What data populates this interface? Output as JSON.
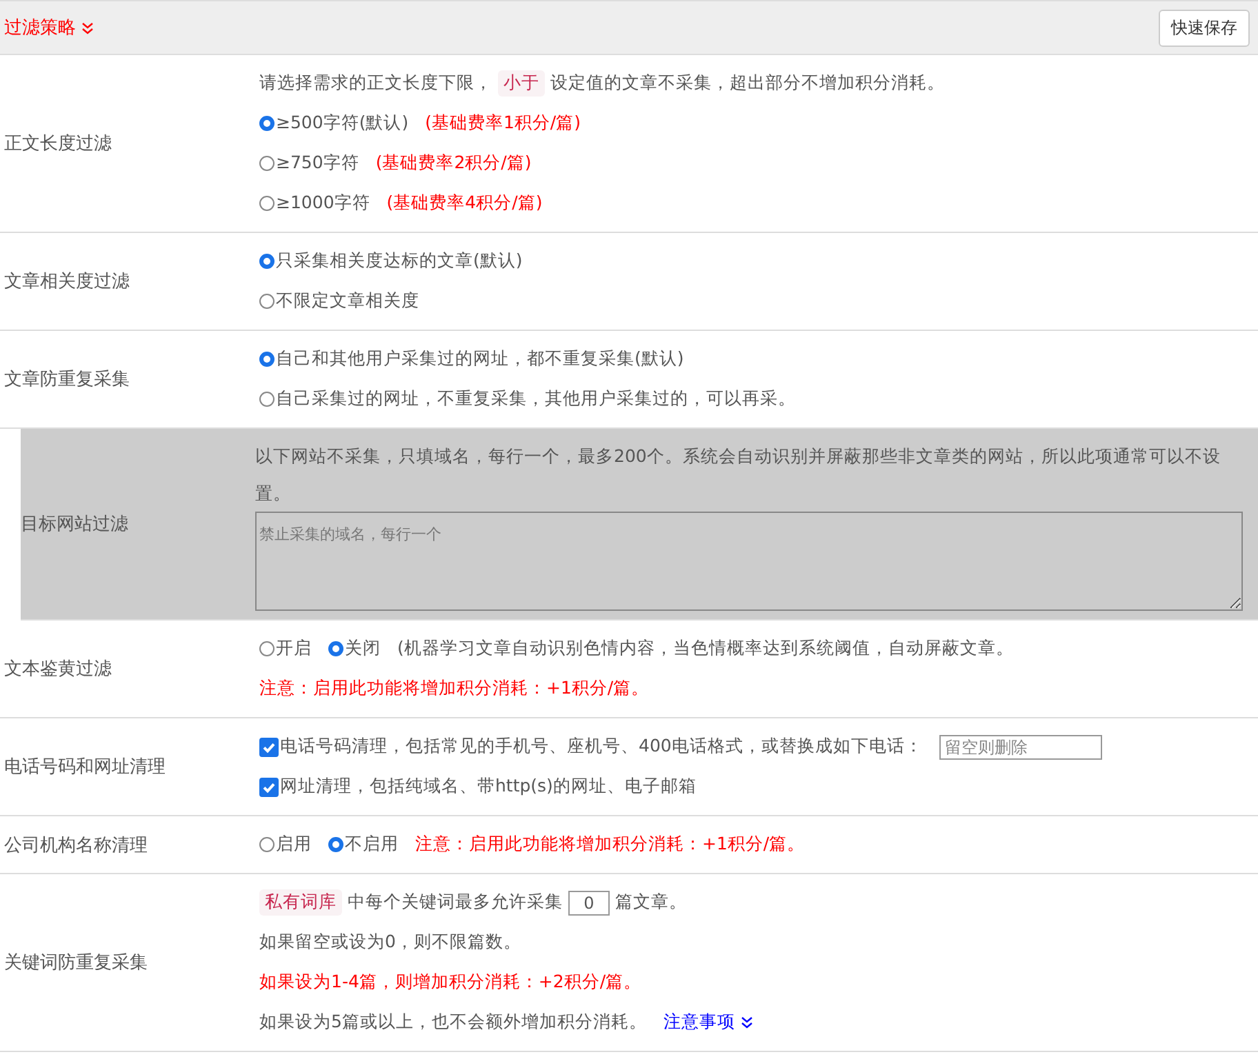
{
  "header": {
    "title": "过滤策略",
    "button": "快速保存"
  },
  "rows": [
    {
      "label": "正文长度过滤",
      "highlighted": false,
      "lines": [
        [
          {
            "kind": "text",
            "warning": false,
            "text": "请选择需求的正文长度下限，"
          },
          {
            "kind": "tag",
            "text": "小于"
          },
          {
            "kind": "text",
            "warning": false,
            "text": "设定值的文章不采集，超出部分不增加积分消耗。"
          }
        ],
        [
          {
            "kind": "radio",
            "label": "≥500字符(默认)",
            "selected": true
          },
          {
            "kind": "text",
            "warning": true,
            "text": "(基础费率1积分/篇)"
          }
        ],
        [
          {
            "kind": "radio",
            "label": "≥750字符",
            "selected": false
          },
          {
            "kind": "text",
            "warning": true,
            "text": "(基础费率2积分/篇)"
          }
        ],
        [
          {
            "kind": "radio",
            "label": "≥1000字符",
            "selected": false
          },
          {
            "kind": "text",
            "warning": true,
            "text": "(基础费率4积分/篇)"
          }
        ]
      ]
    },
    {
      "label": "文章相关度过滤",
      "highlighted": false,
      "lines": [
        [
          {
            "kind": "radio",
            "label": "只采集相关度达标的文章(默认)",
            "selected": true
          }
        ],
        [
          {
            "kind": "radio",
            "label": "不限定文章相关度",
            "selected": false
          }
        ]
      ]
    },
    {
      "label": "文章防重复采集",
      "highlighted": false,
      "lines": [
        [
          {
            "kind": "radio",
            "label": "自己和其他用户采集过的网址，都不重复采集(默认)",
            "selected": true
          }
        ],
        [
          {
            "kind": "radio",
            "label": "自己采集过的网址，不重复采集，其他用户采集过的，可以再采。",
            "selected": false
          }
        ]
      ]
    },
    {
      "label": "目标网站过滤",
      "highlighted": true,
      "lines": [
        [
          {
            "kind": "text",
            "warning": false,
            "text": "以下网站不采集，只填域名，每行一个，最多200个。系统会自动识别并屏蔽那些非文章类的网站，所以此项通常可以不设置。"
          }
        ],
        [
          {
            "kind": "textarea",
            "placeholder": "禁止采集的域名，每行一个"
          }
        ]
      ]
    },
    {
      "label": "文本鉴黄过滤",
      "highlighted": false,
      "lines": [
        [
          {
            "kind": "radio",
            "label": "开启",
            "selected": false
          },
          {
            "kind": "radio",
            "label": "关闭",
            "selected": true
          },
          {
            "kind": "text",
            "warning": false,
            "text": "(机器学习文章自动识别色情内容，当色情概率达到系统阈值，自动屏蔽文章。"
          }
        ],
        [
          {
            "kind": "text",
            "warning": true,
            "text": "注意：启用此功能将增加积分消耗：+1积分/篇。"
          }
        ]
      ]
    },
    {
      "label": "电话号码和网址清理",
      "highlighted": false,
      "lines": [
        [
          {
            "kind": "checkbox",
            "label": "电话号码清理，包括常见的手机号、座机号、400电话格式，或替换成如下电话：",
            "checked": true
          },
          {
            "kind": "field",
            "placeholder": "留空则删除"
          }
        ],
        [
          {
            "kind": "checkbox",
            "label": "网址清理，包括纯域名、带http(s)的网址、电子邮箱",
            "checked": true
          }
        ]
      ]
    },
    {
      "label": "公司机构名称清理",
      "highlighted": false,
      "lines": [
        [
          {
            "kind": "radio",
            "label": "启用",
            "selected": false
          },
          {
            "kind": "radio",
            "label": "不启用",
            "selected": true
          },
          {
            "kind": "text",
            "warning": true,
            "text": "注意：启用此功能将增加积分消耗：+1积分/篇。"
          }
        ]
      ]
    },
    {
      "label": "关键词防重复采集",
      "highlighted": false,
      "lines": [
        [
          {
            "kind": "tag",
            "text": "私有词库"
          },
          {
            "kind": "text",
            "warning": false,
            "text": "中每个关键词最多允许采集"
          },
          {
            "kind": "field",
            "value": "0"
          },
          {
            "kind": "text",
            "warning": false,
            "text": "篇文章。"
          }
        ],
        [
          {
            "kind": "text",
            "warning": false,
            "text": "如果留空或设为0，则不限篇数。"
          }
        ],
        [
          {
            "kind": "text",
            "warning": true,
            "text": "如果设为1-4篇，则增加积分消耗：+2积分/篇。"
          }
        ],
        [
          {
            "kind": "text",
            "warning": false,
            "text": "如果设为5篇或以上，也不会额外增加积分消耗。"
          },
          {
            "kind": "link",
            "text": "注意事项"
          }
        ]
      ]
    }
  ]
}
